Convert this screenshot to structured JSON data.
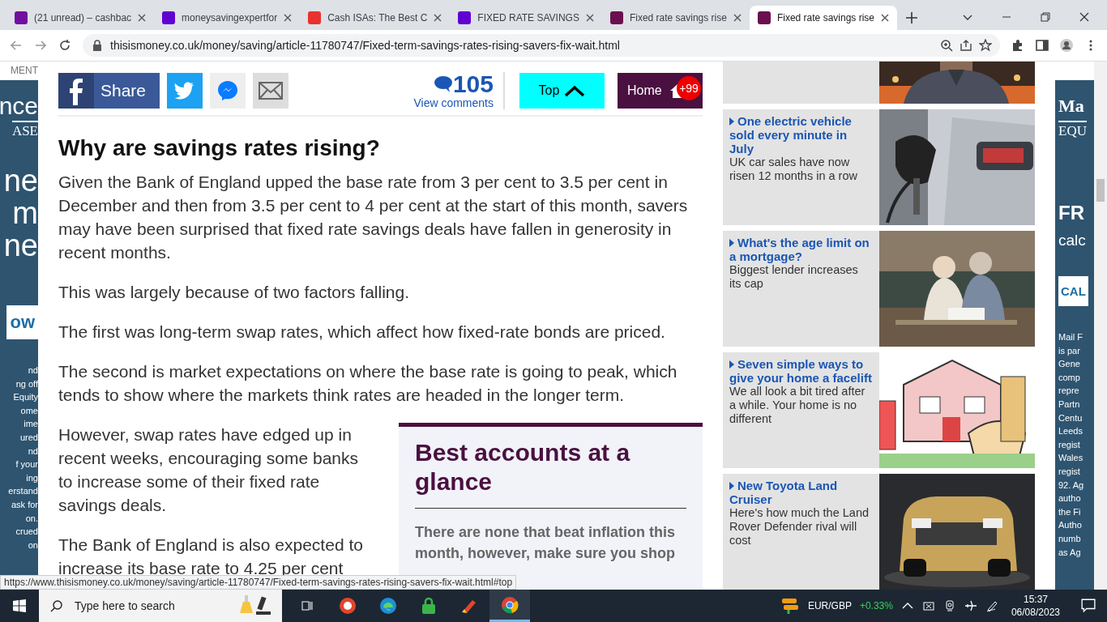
{
  "browser": {
    "tabs": [
      {
        "title": "(21 unread) – cashbac",
        "selected": false,
        "color": "#720e9e"
      },
      {
        "title": "moneysavingexpertfor",
        "selected": false,
        "color": "#6001d2"
      },
      {
        "title": "Cash ISAs: The Best C",
        "selected": false,
        "color": "#e8322d"
      },
      {
        "title": "FIXED RATE SAVINGS",
        "selected": false,
        "color": "#6001d2"
      },
      {
        "title": "Fixed rate savings rise",
        "selected": false,
        "color": "#6b0f4f"
      },
      {
        "title": "Fixed rate savings rise",
        "selected": true,
        "color": "#6b0f4f"
      }
    ],
    "address": "thisismoney.co.uk/money/saving/article-11780747/Fixed-term-savings-rates-rising-savers-fix-wait.html"
  },
  "ad_left": {
    "label": "MENT",
    "logo": "nce",
    "logo_sub": "ASE",
    "headline": [
      "ne",
      "m",
      "ne"
    ],
    "button": "ow",
    "disclaimer": [
      "nd",
      "ng off",
      "Equity",
      "ome",
      "ime",
      "ured",
      "nd",
      "f your",
      "ing",
      "erstand",
      "ask for",
      "on.",
      "crued",
      "on"
    ]
  },
  "share_bar": {
    "share": "Share",
    "comment_count": "105",
    "comments_link": "View comments",
    "top_button": "Top",
    "home_button": "Home",
    "home_badge": "+99"
  },
  "article": {
    "heading": "Why are savings rates rising?",
    "paragraphs": [
      "Given the Bank of England upped the base rate from 3 per cent to 3.5 per cent in December and then from 3.5 per cent to 4 per cent at the start of this month, savers may have been surprised that fixed rate savings deals have fallen in generosity in recent months.",
      "This was largely because of two factors falling.",
      "The first was long-term swap rates, which affect how fixed-rate bonds are priced.",
      "The second is market expectations on where the base rate is going to peak, which tends to show where the markets think rates are headed in the longer term."
    ],
    "side_paragraphs": [
      "However, swap rates have edged up in recent weeks, encouraging some banks to increase some of their fixed rate savings deals.",
      "The Bank of England is also expected to increase its base rate to 4.25 per cent"
    ],
    "box": {
      "title": "Best accounts at a glance",
      "text": "There are none that beat inflation this month, however, make sure you shop"
    }
  },
  "sidebar": {
    "items": [
      {
        "title": "One electric vehicle sold every minute in July",
        "summary": "UK car sales have now risen 12 months in a row"
      },
      {
        "title": "What's the age limit on a mortgage?",
        "summary": "Biggest lender increases its cap"
      },
      {
        "title": "Seven simple ways to give your home a facelift",
        "summary": "We all look a bit tired after a while. Your home is no different"
      },
      {
        "title": "New Toyota Land Cruiser",
        "summary": "Here's how much the Land Rover Defender rival will cost"
      }
    ]
  },
  "ad_right": {
    "logo": "Ma",
    "logo_sub": "EQU",
    "headline": [
      "FR",
      "calc"
    ],
    "button": "CAL",
    "disclaimer": [
      "Mail F",
      "is par",
      "Gene",
      "comp",
      "repre",
      "Partn",
      "Centu",
      "Leeds",
      "regist",
      "Wales",
      "regist",
      "92. Ag",
      "autho",
      "the Fi",
      "Autho",
      "numb",
      "as Ag"
    ]
  },
  "status_link": "https://www.thisismoney.co.uk/money/saving/article-11780747/Fixed-term-savings-rates-rising-savers-fix-wait.html#top",
  "taskbar": {
    "search_placeholder": "Type here to search",
    "ticker": "EUR/GBP",
    "change": "+0.33%",
    "time": "15:37",
    "date": "06/08/2023"
  }
}
